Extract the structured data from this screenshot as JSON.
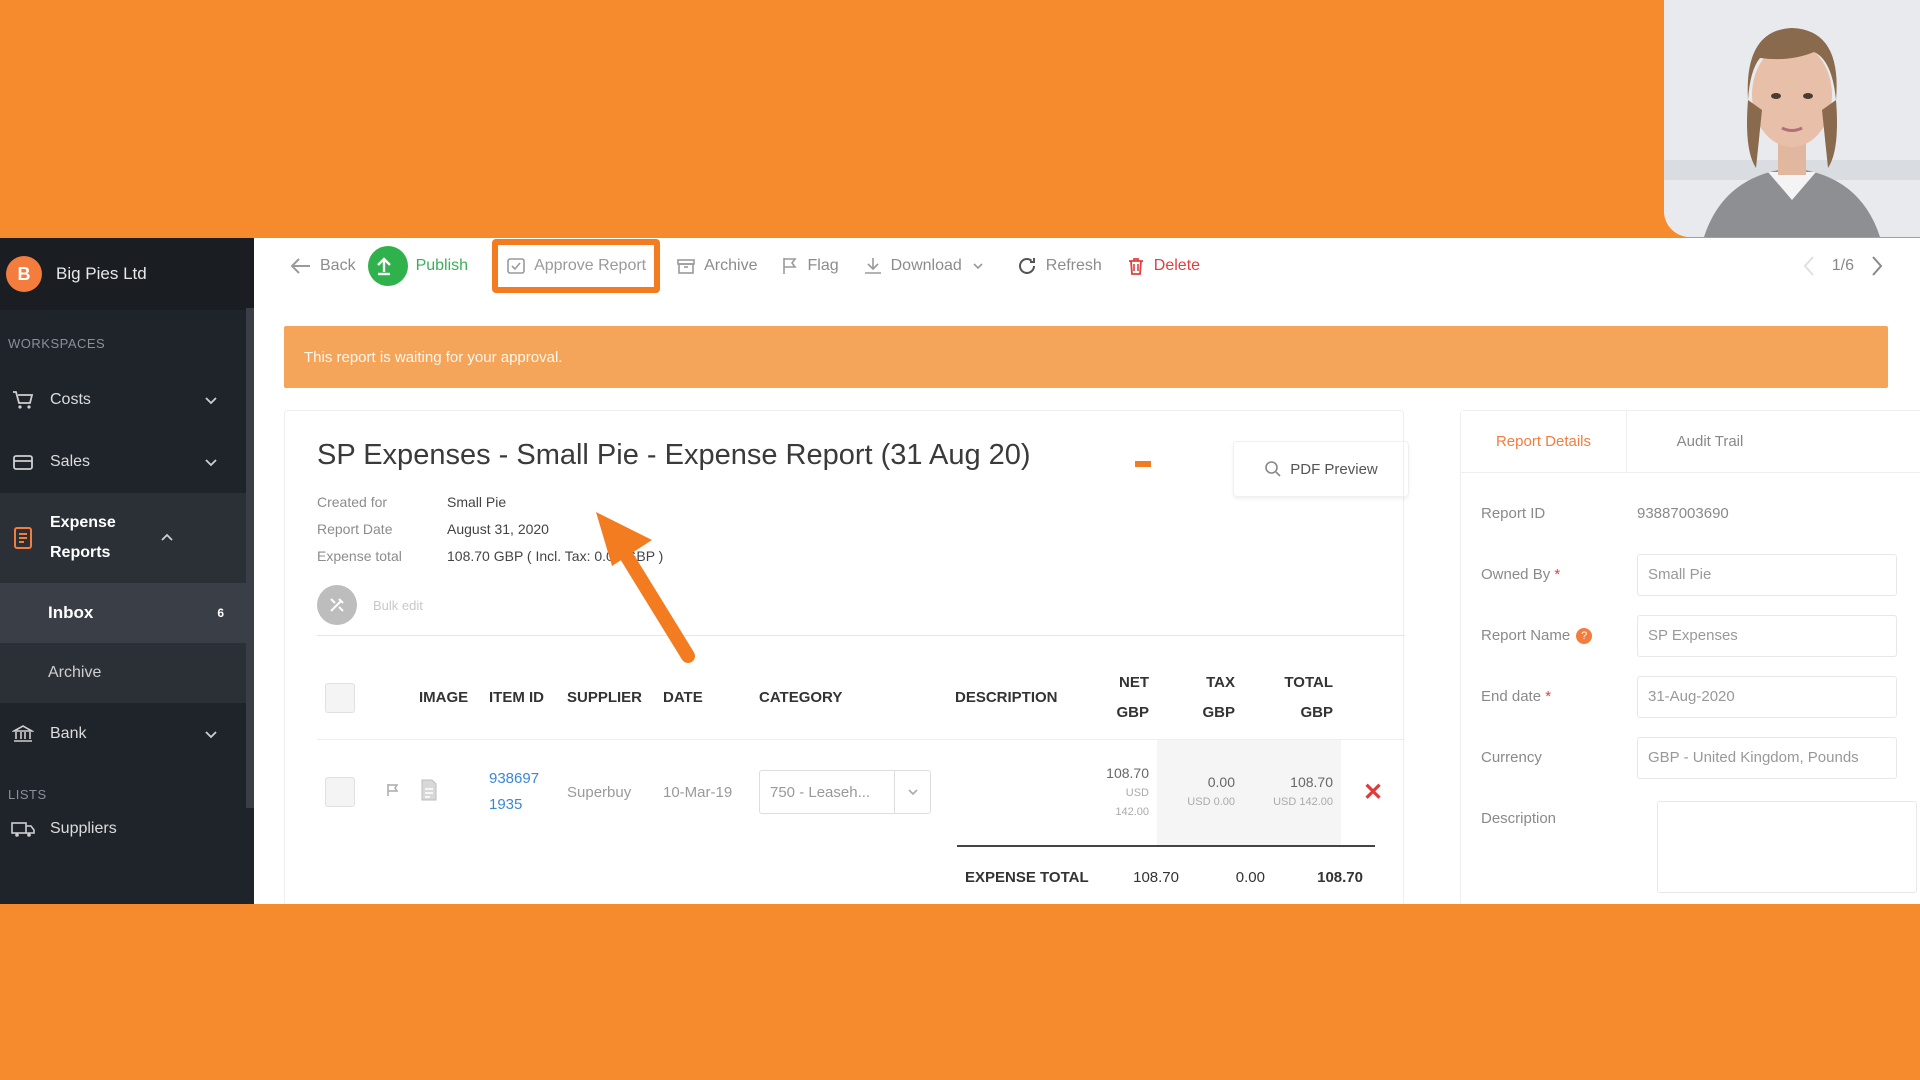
{
  "sidebar": {
    "company_initial": "B",
    "company_name": "Big Pies Ltd",
    "workspaces_label": "WORKSPACES",
    "items": [
      {
        "label": "Costs"
      },
      {
        "label": "Sales"
      },
      {
        "label": "Expense Reports"
      },
      {
        "label": "Bank"
      }
    ],
    "sub_items": [
      {
        "label": "Inbox",
        "badge": "6"
      },
      {
        "label": "Archive"
      }
    ],
    "lists_label": "LISTS",
    "suppliers_label": "Suppliers"
  },
  "toolbar": {
    "back": "Back",
    "publish": "Publish",
    "approve": "Approve Report",
    "archive": "Archive",
    "flag": "Flag",
    "download": "Download",
    "refresh": "Refresh",
    "delete": "Delete",
    "pager": "1/6"
  },
  "banner": "This report is waiting for your approval.",
  "report": {
    "title": "SP Expenses - Small Pie - Expense Report (31 Aug 20)",
    "created_for_label": "Created for",
    "created_for": "Small Pie",
    "report_date_label": "Report Date",
    "report_date": "August 31, 2020",
    "expense_total_label": "Expense total",
    "expense_total": "108.70 GBP ( Incl. Tax: 0.00 GBP )",
    "pdf_preview": "PDF Preview",
    "bulk_edit": "Bulk edit"
  },
  "table": {
    "headers": {
      "image": "IMAGE",
      "item_id": "ITEM ID",
      "supplier": "SUPPLIER",
      "date": "DATE",
      "category": "CATEGORY",
      "description": "DESCRIPTION",
      "net_1": "NET",
      "net_2": "GBP",
      "tax_1": "TAX",
      "tax_2": "GBP",
      "total_1": "TOTAL",
      "total_2": "GBP"
    },
    "row": {
      "item_id_1": "938697",
      "item_id_2": "1935",
      "supplier": "Superbuy",
      "date": "10-Mar-19",
      "category": "750 - Leaseh...",
      "description": "",
      "net": "108.70",
      "net_sub_1": "USD",
      "net_sub_2": "142.00",
      "tax": "0.00",
      "tax_sub": "USD 0.00",
      "total": "108.70",
      "total_sub": "USD 142.00"
    },
    "total_label": "EXPENSE TOTAL",
    "total_net": "108.70",
    "total_tax": "0.00",
    "total_total": "108.70"
  },
  "details": {
    "tab_details": "Report Details",
    "tab_audit": "Audit Trail",
    "report_id_label": "Report ID",
    "report_id": "93887003690",
    "owned_by_label": "Owned By",
    "owned_by": "Small Pie",
    "report_name_label": "Report Name",
    "report_name": "SP Expenses",
    "end_date_label": "End date",
    "end_date": "31-Aug-2020",
    "currency_label": "Currency",
    "currency": "GBP - United Kingdom, Pounds",
    "description_label": "Description",
    "required_mark": "*",
    "help_mark": "?"
  },
  "colors": {
    "frame": "#F68B2E",
    "sidebar": "#1F232A",
    "publish": "#2FB14C",
    "banner": "#F5A559",
    "accent": "#F47C3C",
    "delete": "#E0403F"
  }
}
